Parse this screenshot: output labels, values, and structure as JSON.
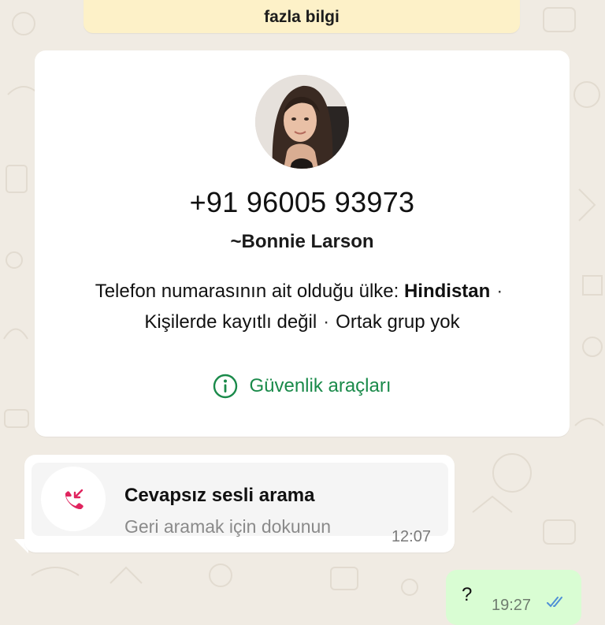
{
  "banner": {
    "label": "fazla bilgi"
  },
  "contact": {
    "phone": "+91 96005 93973",
    "name": "~Bonnie Larson",
    "country_prefix": "Telefon numarasının ait olduğu ülke: ",
    "country": "Hindistan",
    "not_saved": "Kişilerde kayıtlı değil",
    "no_groups": "Ortak grup yok",
    "separator": "·",
    "safety_tools": "Güvenlik araçları",
    "info_icon": "info-circle-icon",
    "accent_color": "#1a8a4a"
  },
  "missed_call": {
    "title": "Cevapsız sesli arama",
    "subtitle": "Geri aramak için dokunun",
    "time": "12:07",
    "icon": "missed-call-icon",
    "icon_color": "#e0245e"
  },
  "outgoing": {
    "text": "?",
    "time": "19:27",
    "status_icon": "double-check-icon"
  }
}
